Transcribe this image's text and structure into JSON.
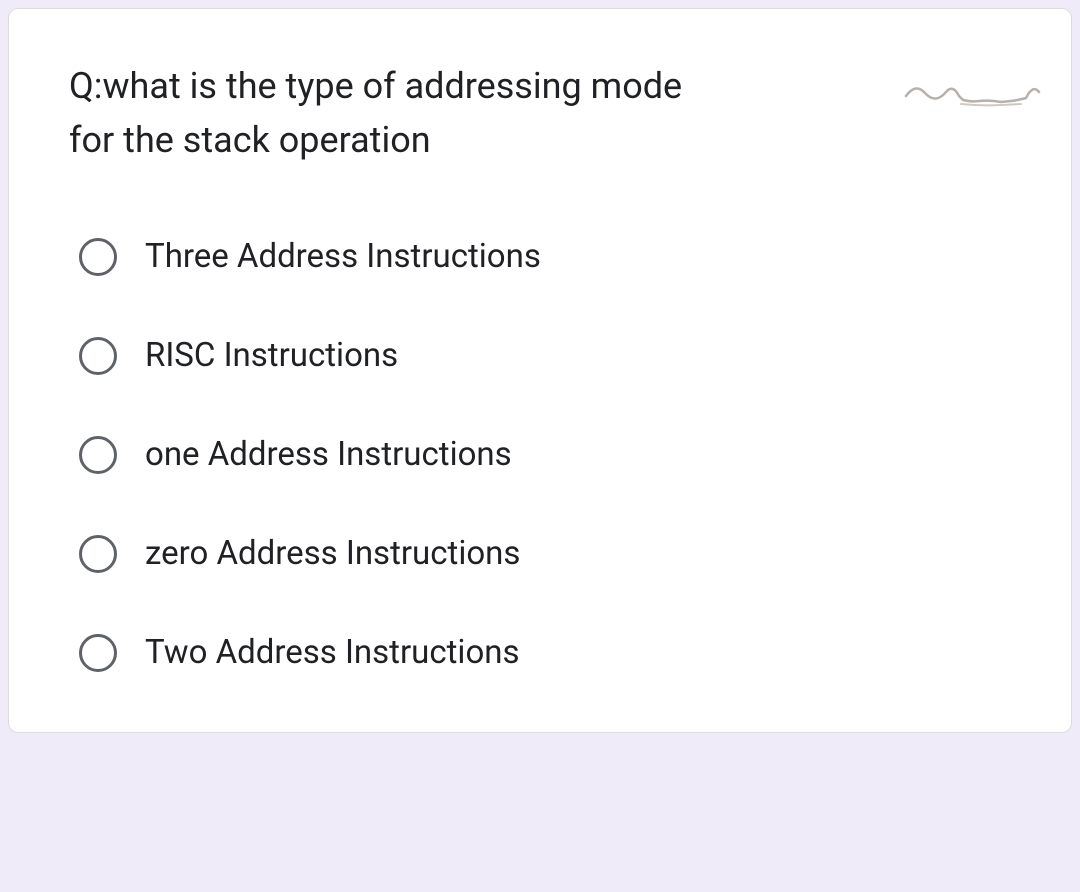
{
  "question": "Q:what is the type of addressing mode for the stack operation",
  "options": [
    {
      "label": "Three Address Instructions"
    },
    {
      "label": "RISC Instructions"
    },
    {
      "label": "one Address Instructions"
    },
    {
      "label": "zero Address Instructions"
    },
    {
      "label": "Two Address Instructions"
    }
  ]
}
